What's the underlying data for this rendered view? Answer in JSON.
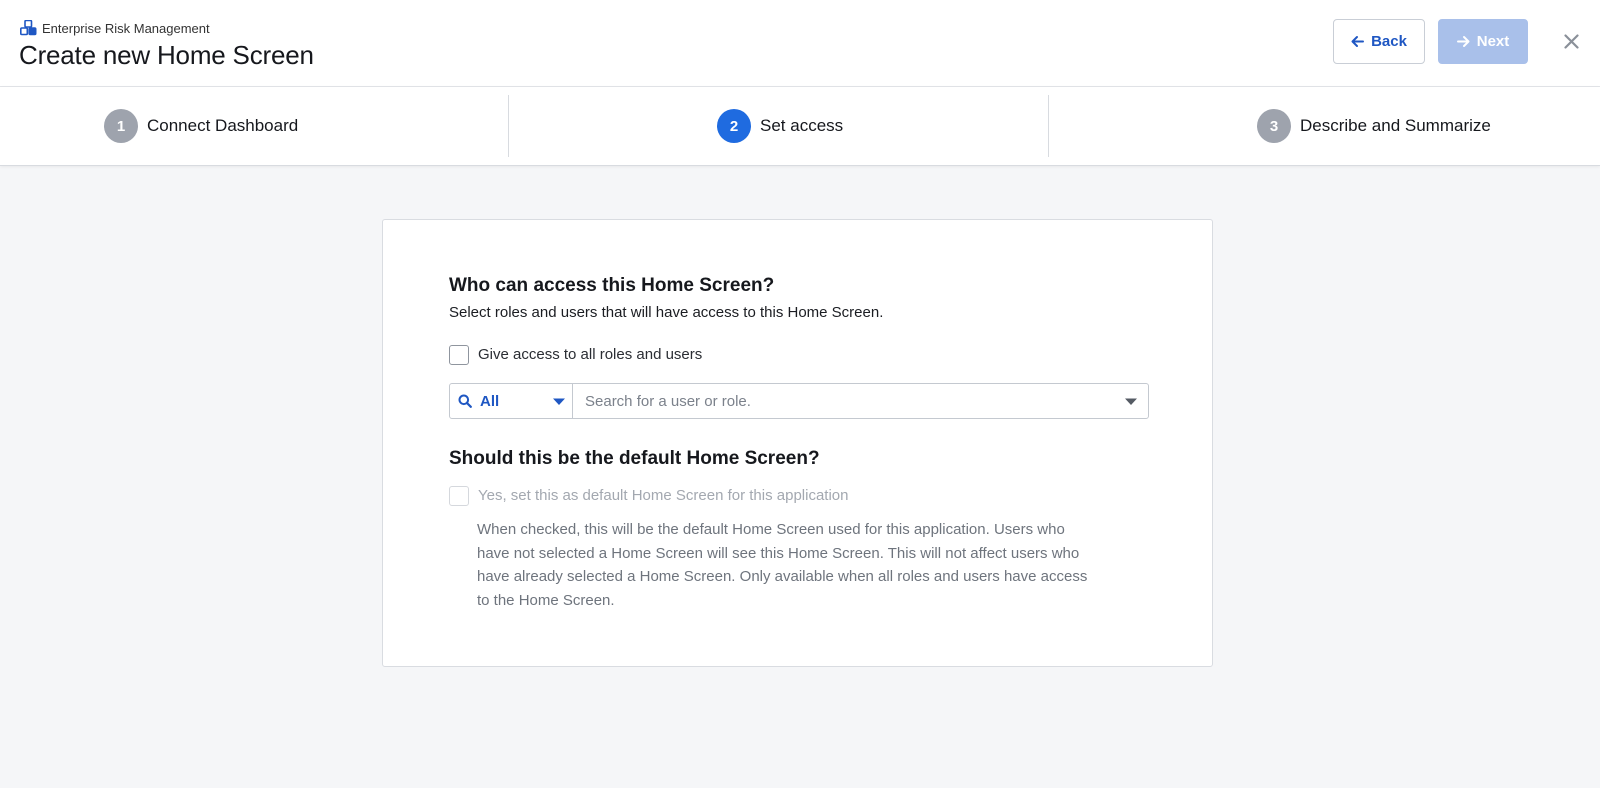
{
  "header": {
    "app_name": "Enterprise Risk Management",
    "title": "Create new Home Screen",
    "back_label": "Back",
    "next_label": "Next"
  },
  "steps": [
    {
      "number": "1",
      "label": "Connect Dashboard",
      "active": false
    },
    {
      "number": "2",
      "label": "Set access",
      "active": true
    },
    {
      "number": "3",
      "label": "Describe and Summarize",
      "active": false
    }
  ],
  "access": {
    "title": "Who can access this Home Screen?",
    "description": "Select roles and users that will have access to this Home Screen.",
    "all_checkbox_label": "Give access to all roles and users",
    "all_checked": false,
    "filter_value": "All",
    "search_placeholder": "Search for a user or role."
  },
  "default_section": {
    "title": "Should this be the default Home Screen?",
    "checkbox_label": "Yes, set this as default Home Screen for this application",
    "checked": false,
    "disabled": true,
    "help_text": "When checked, this will be the default Home Screen used for this application. Users who have not selected a Home Screen will see this Home Screen. This will not affect users who have already selected a Home Screen. Only available when all roles and users have access to the Home Screen."
  },
  "colors": {
    "accent": "#1f6be0",
    "link": "#1f57c3",
    "step_inactive": "#9ea3ad",
    "next_disabled": "#a9c0ea",
    "background": "#f5f6f8"
  },
  "icons": [
    "app-logo-icon",
    "arrow-left-icon",
    "arrow-right-icon",
    "close-icon",
    "search-icon",
    "caret-down-icon"
  ]
}
